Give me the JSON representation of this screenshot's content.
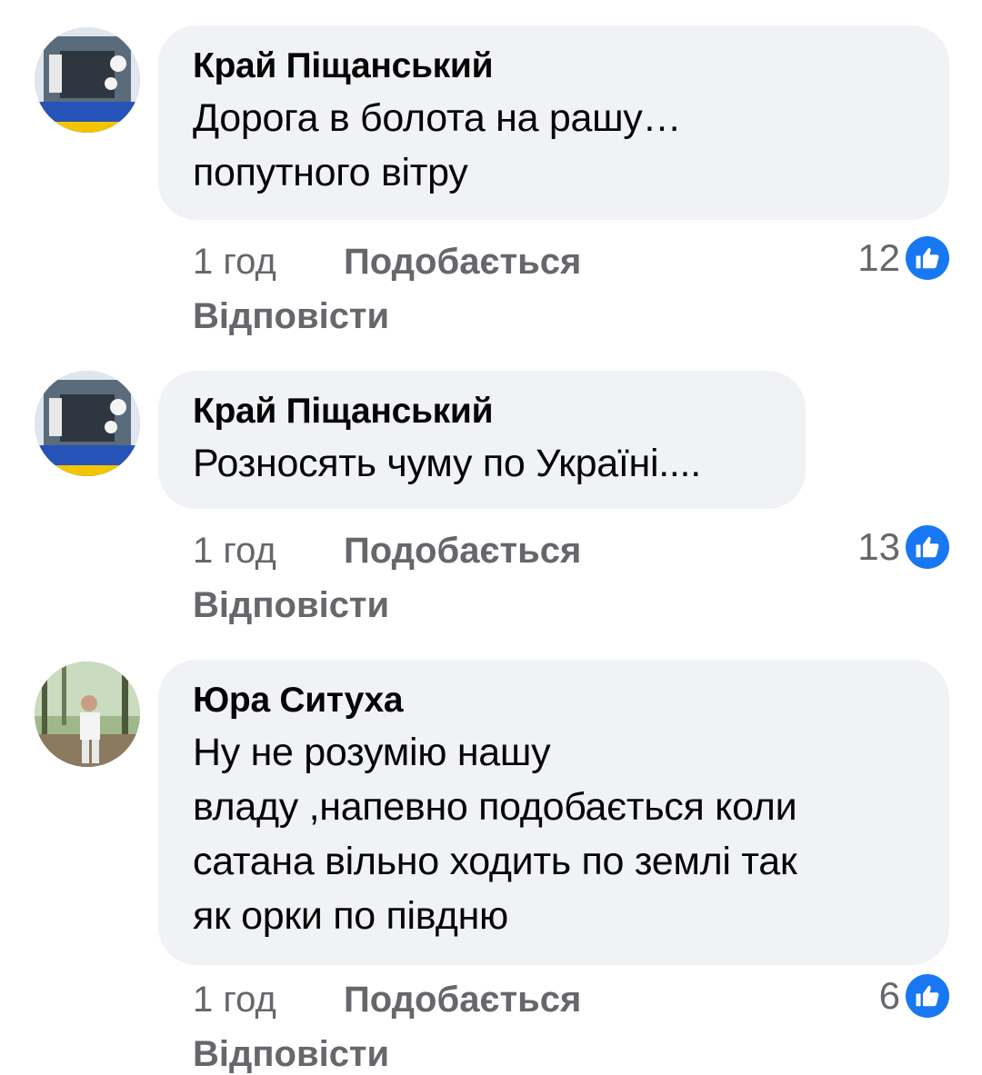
{
  "colors": {
    "bubble": "#f0f2f5",
    "meta_text": "#65676b",
    "like_badge": "#1877f2"
  },
  "comments": [
    {
      "author": "Край Піщанський",
      "text": "Дорога в болота на рашу…\nпопутного вітру",
      "time": "1 год",
      "like_label": "Подобається",
      "reply_label": "Відповісти",
      "reaction_count": "12",
      "reaction_icon": "thumbs-up-icon"
    },
    {
      "author": "Край Піщанський",
      "text": "Розносять чуму по Україні....",
      "time": "1 год",
      "like_label": "Подобається",
      "reply_label": "Відповісти",
      "reaction_count": "13",
      "reaction_icon": "thumbs-up-icon"
    },
    {
      "author": "Юра Ситуха",
      "text": "Ну не розумію нашу\nвладу ,напевно подобається коли\nсатана вільно ходить по землі так\nяк орки по півдню",
      "time": "1 год",
      "like_label": "Подобається",
      "reply_label": "Відповісти",
      "reaction_count": "6",
      "reaction_icon": "thumbs-up-icon"
    }
  ]
}
